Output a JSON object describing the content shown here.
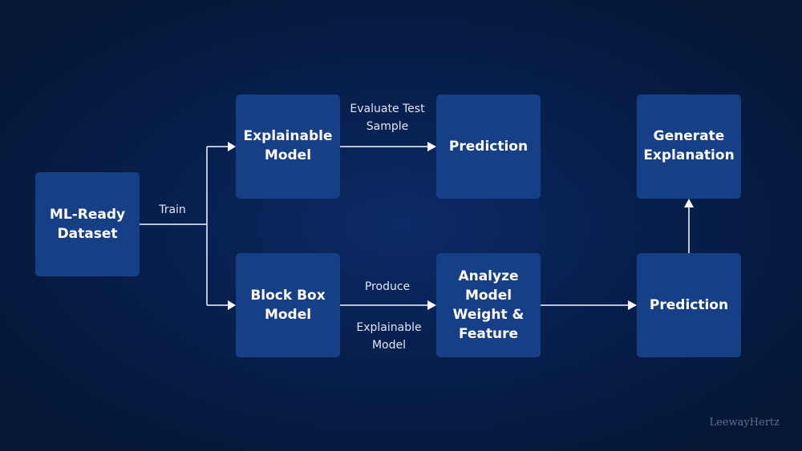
{
  "diagram": {
    "nodes": {
      "dataset": {
        "line1": "ML-Ready",
        "line2": "Dataset"
      },
      "explainable_model": {
        "line1": "Explainable",
        "line2": "Model"
      },
      "prediction_top": {
        "line1": "Prediction"
      },
      "generate_explanation": {
        "line1": "Generate",
        "line2": "Explanation"
      },
      "black_box_model": {
        "line1": "Block Box",
        "line2": "Model"
      },
      "analyze": {
        "line1": "Analyze",
        "line2": "Model",
        "line3": "Weight &",
        "line4": "Feature"
      },
      "prediction_bottom": {
        "line1": "Prediction"
      }
    },
    "edge_labels": {
      "train": "Train",
      "evaluate_line1": "Evaluate Test",
      "evaluate_line2": "Sample",
      "produce": "Produce",
      "explainable_line1": "Explainable",
      "explainable_line2": "Model"
    },
    "colors": {
      "box": "#163f85",
      "line": "#b9c3d6",
      "arrowhead": "#ffffff"
    }
  },
  "watermark": "LeewayHertz"
}
